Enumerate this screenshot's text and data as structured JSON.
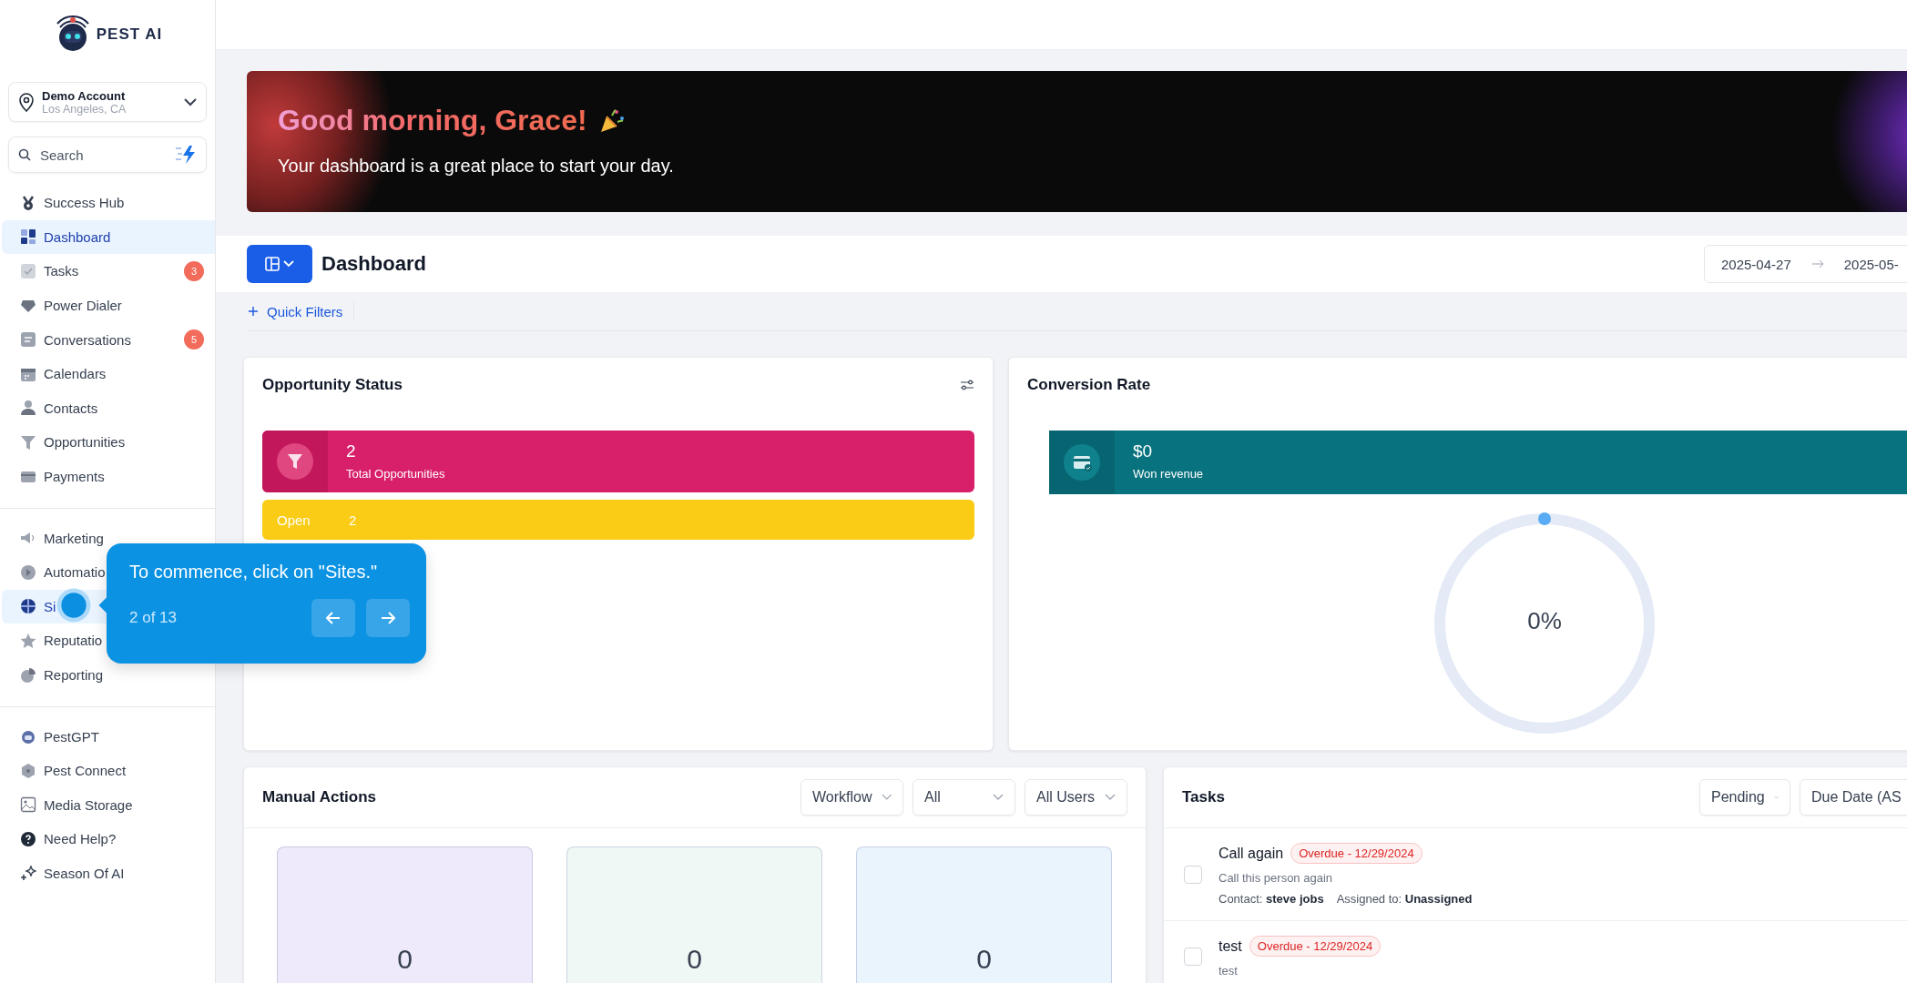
{
  "sidebar": {
    "logo": "PEST AI",
    "account": {
      "name": "Demo Account",
      "location": "Los Angeles, CA"
    },
    "search": {
      "placeholder": "Search"
    },
    "groups": [
      {
        "items": [
          {
            "label": "Success Hub",
            "selected": false
          },
          {
            "label": "Dashboard",
            "selected": true
          },
          {
            "label": "Tasks",
            "selected": false,
            "badge": "3"
          },
          {
            "label": "Power Dialer",
            "selected": false
          },
          {
            "label": "Conversations",
            "selected": false,
            "badge": "5"
          },
          {
            "label": "Calendars",
            "selected": false
          },
          {
            "label": "Contacts",
            "selected": false
          },
          {
            "label": "Opportunities",
            "selected": false
          },
          {
            "label": "Payments",
            "selected": false
          }
        ]
      },
      {
        "items": [
          {
            "label": "Marketing",
            "selected": false
          },
          {
            "label": "Automatio",
            "selected": false
          },
          {
            "label": "Si",
            "selected": true
          },
          {
            "label": "Reputatio",
            "selected": false
          },
          {
            "label": "Reporting",
            "selected": false
          }
        ]
      },
      {
        "items": [
          {
            "label": "PestGPT",
            "selected": false
          },
          {
            "label": "Pest Connect",
            "selected": false
          },
          {
            "label": "Media Storage",
            "selected": false
          },
          {
            "label": "Need Help?",
            "selected": false
          },
          {
            "label": "Season Of AI",
            "selected": false
          }
        ]
      }
    ]
  },
  "banner": {
    "title": "Good morning, Grace!",
    "subtitle": "Your dashboard is a great place to start your day."
  },
  "toolbar": {
    "title": "Dashboard",
    "date_from": "2025-04-27",
    "date_to": "2025-05-",
    "quick_filters": "Quick Filters"
  },
  "opportunity_status": {
    "title": "Opportunity Status",
    "total": {
      "value": "2",
      "label": "Total Opportunities"
    },
    "stages": [
      {
        "label": "Open",
        "count": "2"
      }
    ]
  },
  "conversion_rate": {
    "title": "Conversion Rate",
    "revenue": {
      "value": "$0",
      "label": "Won revenue"
    },
    "percent": "0%"
  },
  "manual_actions": {
    "title": "Manual Actions",
    "filters": [
      "Workflow",
      "All",
      "All Users"
    ],
    "tiles": [
      {
        "value": "0",
        "color": "#eeeafb"
      },
      {
        "value": "0",
        "color": "#f0f8f5"
      },
      {
        "value": "0",
        "color": "#eaf4fd"
      }
    ]
  },
  "tasks": {
    "title": "Tasks",
    "filters": [
      "Pending",
      "Due Date (AS"
    ],
    "items": [
      {
        "title": "Call again",
        "badge": "Overdue - 12/29/2024",
        "description": "Call this person again",
        "contact": "Contact: **steve jobs**",
        "assigned": "Assigned to: **Unassigned**",
        "checked": false
      },
      {
        "title": "test",
        "badge": "Overdue - 12/29/2024",
        "description": "test",
        "checked": false
      }
    ]
  },
  "tour": {
    "text": "To commence, click on \"Sites.\"",
    "step": "2 of 13"
  }
}
